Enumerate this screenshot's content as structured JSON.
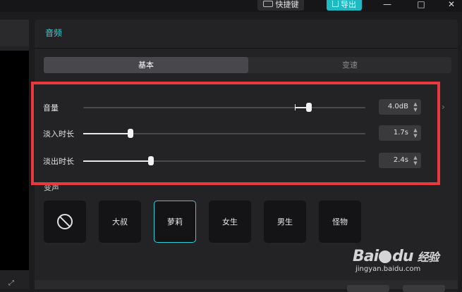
{
  "topbar": {
    "shortcut_label": "快捷键",
    "export_label": "导出"
  },
  "panel": {
    "title": "音频",
    "tabs": [
      {
        "label": "基本",
        "active": true
      },
      {
        "label": "变速",
        "active": false
      }
    ],
    "sliders": [
      {
        "label": "音量",
        "value": "4.0dB",
        "level": 0.8
      },
      {
        "label": "淡入时长",
        "value": "1.7s",
        "level": 0.17
      },
      {
        "label": "淡出时长",
        "value": "2.4s",
        "level": 0.24
      }
    ],
    "voice_section_label": "变声",
    "voice_presets": [
      {
        "label": "",
        "icon": "none-icon"
      },
      {
        "label": "大叔"
      },
      {
        "label": "萝莉",
        "selected": true
      },
      {
        "label": "女生"
      },
      {
        "label": "男生"
      },
      {
        "label": "怪物"
      }
    ]
  },
  "watermark": {
    "logo_text": "Bai",
    "logo_text2": "du",
    "sub_text": "经验",
    "url_text": "jingyan.baidu.com"
  },
  "colors": {
    "accent": "#2ed0d8",
    "highlight": "#e8393f",
    "export": "#1fb9c4"
  }
}
